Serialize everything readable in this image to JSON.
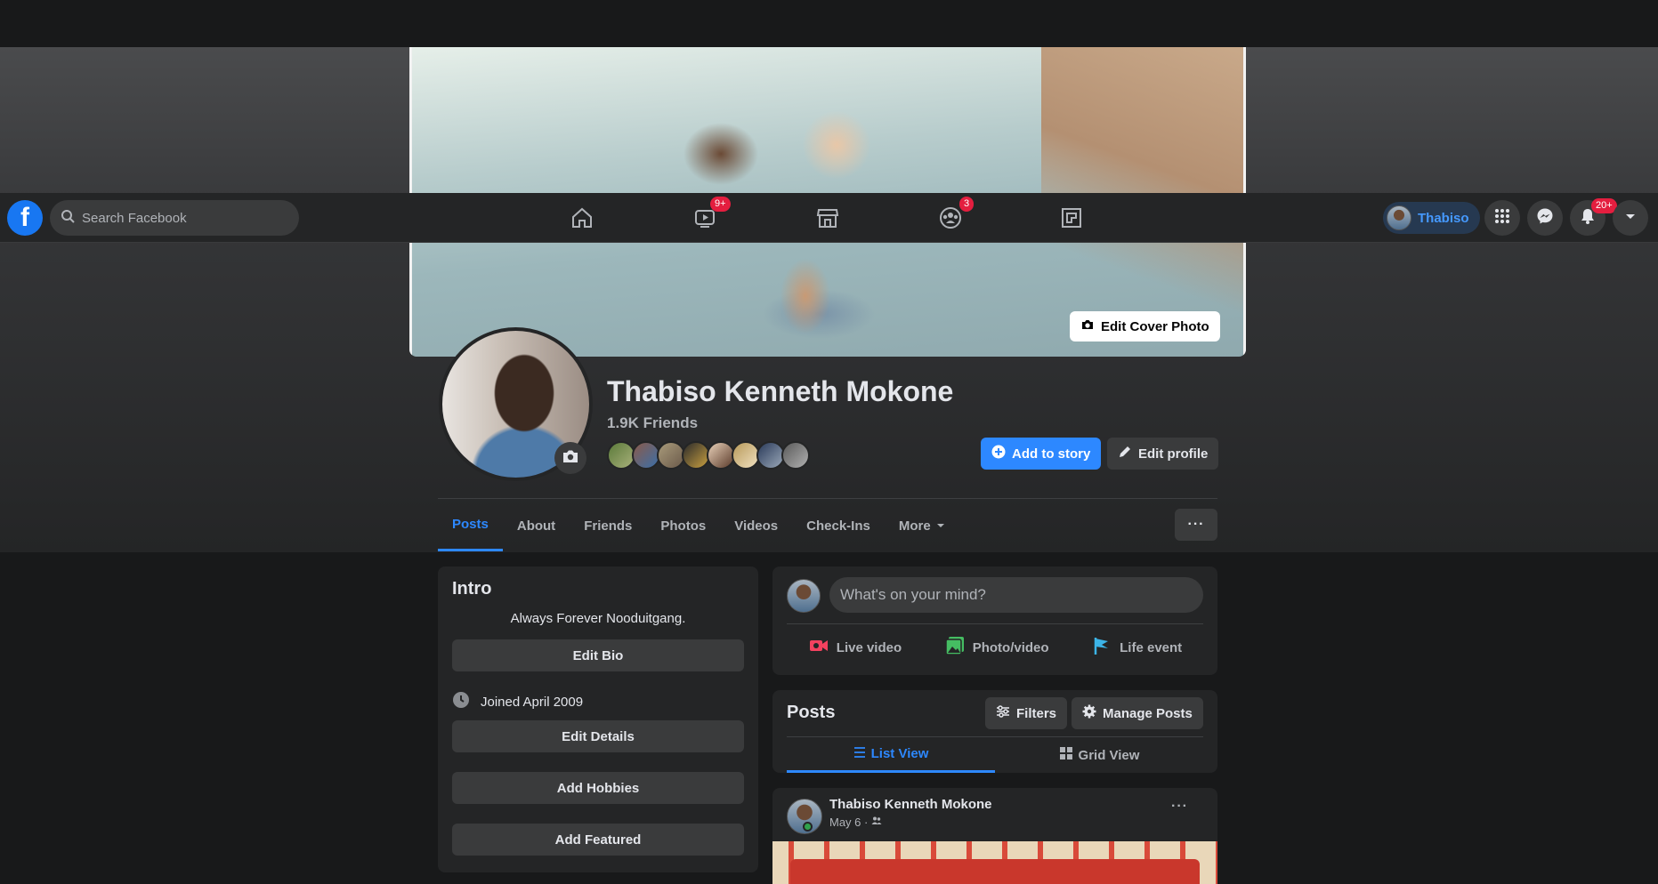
{
  "navbar": {
    "logo": "f",
    "search_placeholder": "Search Facebook",
    "watch_badge": "9+",
    "groups_badge": "3",
    "profile_name": "Thabiso",
    "notifications_badge": "20+"
  },
  "cover": {
    "edit_cover_label": "Edit Cover Photo"
  },
  "profile": {
    "name": "Thabiso Kenneth Mokone",
    "friends_count": "1.9K Friends",
    "add_story_label": "Add to story",
    "edit_profile_label": "Edit profile"
  },
  "tabs": [
    {
      "label": "Posts"
    },
    {
      "label": "About"
    },
    {
      "label": "Friends"
    },
    {
      "label": "Photos"
    },
    {
      "label": "Videos"
    },
    {
      "label": "Check-Ins"
    },
    {
      "label": "More"
    }
  ],
  "more_dots": "···",
  "intro": {
    "title": "Intro",
    "bio": "Always Forever Nooduitgang.",
    "edit_bio": "Edit Bio",
    "joined": "Joined April 2009",
    "edit_details": "Edit Details",
    "add_hobbies": "Add Hobbies",
    "add_featured": "Add Featured"
  },
  "composer": {
    "placeholder": "What's on your mind?",
    "live_video": "Live video",
    "photo_video": "Photo/video",
    "life_event": "Life event"
  },
  "posts_section": {
    "title": "Posts",
    "filters": "Filters",
    "manage": "Manage Posts",
    "list_view": "List View",
    "grid_view": "Grid View"
  },
  "post": {
    "author": "Thabiso Kenneth Mokone",
    "date": "May 6 ·",
    "more": "···"
  },
  "colors": {
    "accent": "#2d88ff",
    "badge": "#e41e3f",
    "background": "#18191a",
    "card": "#242526"
  }
}
